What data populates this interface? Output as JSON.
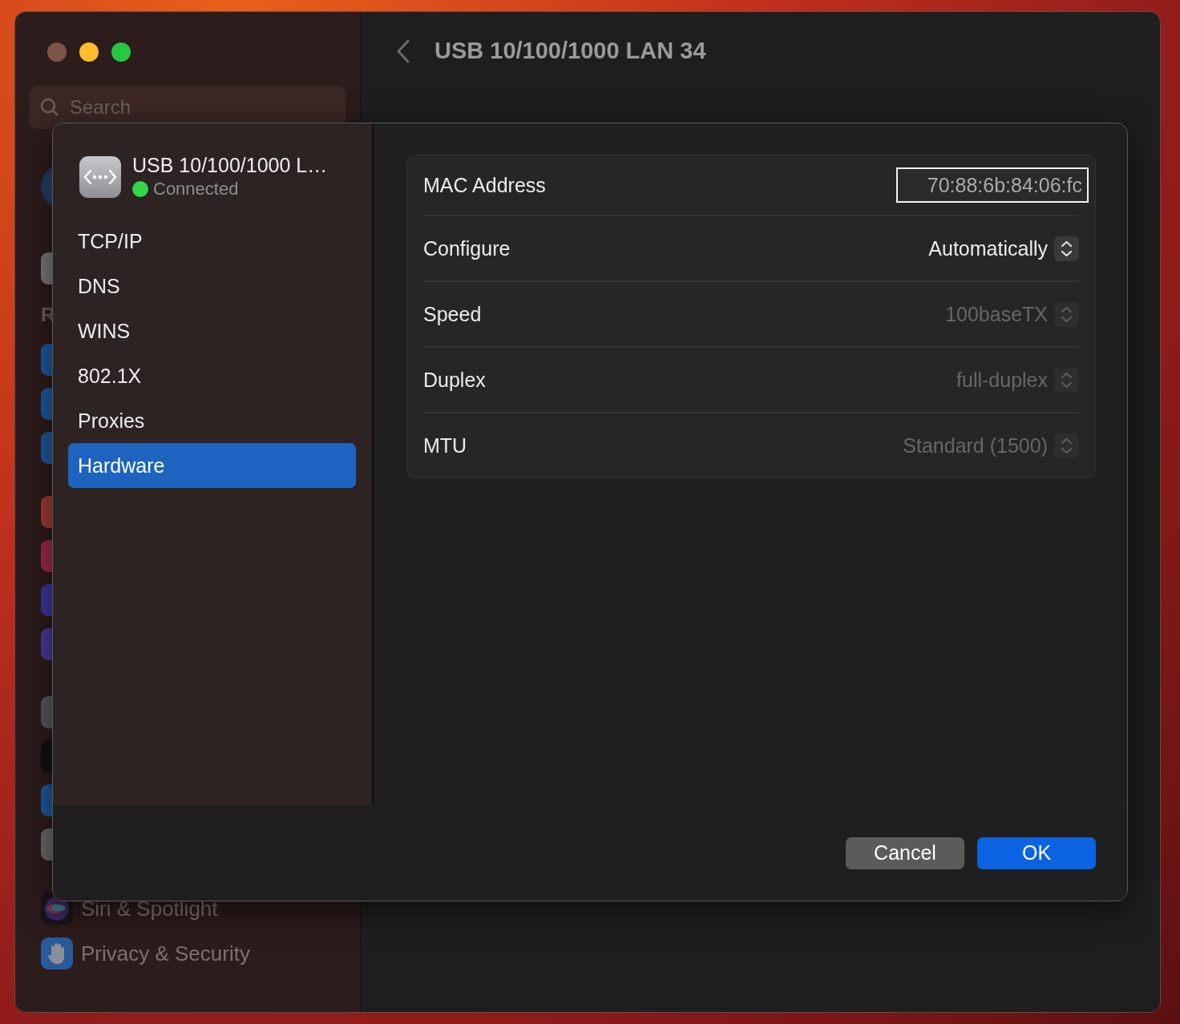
{
  "background_window": {
    "title": "USB 10/100/1000 LAN 34",
    "search": {
      "placeholder": "Search"
    },
    "section_label": "R",
    "sidebar_items": [
      {
        "label": "Siri & Spotlight",
        "kind": "siri"
      },
      {
        "label": "Privacy & Security",
        "kind": "privacy"
      }
    ]
  },
  "sheet": {
    "service": {
      "name": "USB 10/100/1000 L…",
      "status": "Connected",
      "connected": true
    },
    "nav": [
      {
        "label": "TCP/IP",
        "selected": false
      },
      {
        "label": "DNS",
        "selected": false
      },
      {
        "label": "WINS",
        "selected": false
      },
      {
        "label": "802.1X",
        "selected": false
      },
      {
        "label": "Proxies",
        "selected": false
      },
      {
        "label": "Hardware",
        "selected": true
      }
    ],
    "rows": [
      {
        "kind": "field",
        "label": "MAC Address",
        "value": "70:88:6b:84:06:fc"
      },
      {
        "kind": "popup",
        "label": "Configure",
        "value": "Automatically",
        "disabled": false
      },
      {
        "kind": "popup",
        "label": "Speed",
        "value": "100baseTX",
        "disabled": true
      },
      {
        "kind": "popup",
        "label": "Duplex",
        "value": "full-duplex",
        "disabled": true
      },
      {
        "kind": "popup",
        "label": "MTU",
        "value": "Standard (1500)",
        "disabled": true
      }
    ],
    "buttons": [
      {
        "label": "Cancel",
        "primary": false
      },
      {
        "label": "OK",
        "primary": true
      }
    ]
  }
}
